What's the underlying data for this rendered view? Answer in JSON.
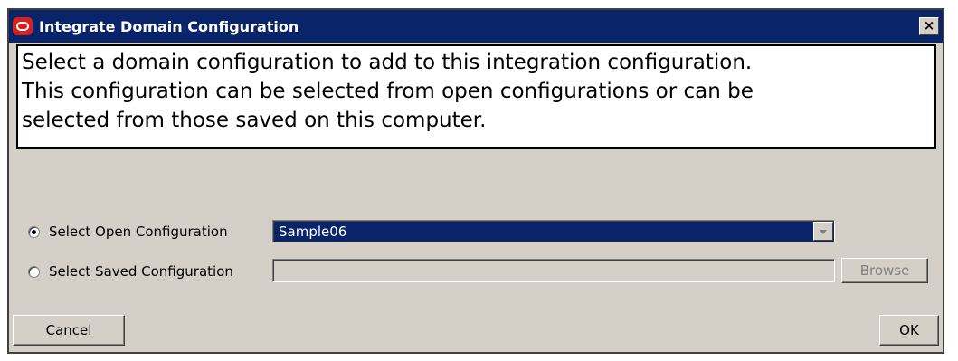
{
  "window": {
    "title": "Integrate Domain Configuration",
    "logo_icon": "oracle-logo-icon",
    "close_label": "×"
  },
  "message": {
    "lines": [
      "Select a domain configuration to add to this integration configuration.",
      "This configuration can be selected from open configurations or can be",
      "selected from those saved on this computer."
    ]
  },
  "options": {
    "open": {
      "label": "Select Open Configuration",
      "checked": true
    },
    "saved": {
      "label": "Select Saved Configuration",
      "checked": false
    }
  },
  "open_config": {
    "selected_value": "Sample06"
  },
  "saved_config": {
    "value": ""
  },
  "buttons": {
    "browse": "Browse",
    "cancel": "Cancel",
    "ok": "OK"
  },
  "colors": {
    "title_bar": "#0a246a",
    "dialog_bg": "#d4d0c8",
    "selection": "#0a246a"
  }
}
